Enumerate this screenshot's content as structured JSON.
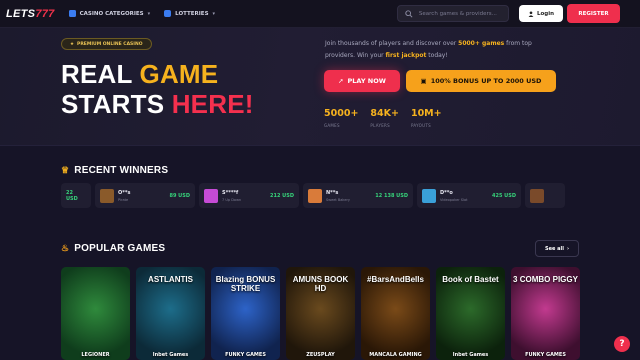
{
  "header": {
    "logo_main": "LETS",
    "logo_accent": "777",
    "menu": [
      {
        "label": "CASINO CATEGORIES",
        "icon": "grid-icon"
      },
      {
        "label": "LOTTERIES",
        "icon": "ticket-icon"
      }
    ],
    "search_placeholder": "Search games & providers...",
    "login_label": "Login",
    "register_label": "REGISTER"
  },
  "hero": {
    "badge": "PREMIUM ONLINE CASINO",
    "headline_line1_a": "REAL ",
    "headline_line1_b": "GAME",
    "headline_line2_a": "STARTS ",
    "headline_line2_b": "HERE!",
    "sub_a": "Join thousands of players and discover over ",
    "sub_highlight1": "5000+ games",
    "sub_b": " from top providers. Win your ",
    "sub_highlight2": "first jackpot",
    "sub_c": " today!",
    "play_label": "PLAY NOW",
    "bonus_label": "100% BONUS UP TO 2000 USD",
    "stats": [
      {
        "value": "5000+",
        "label": "GAMES"
      },
      {
        "value": "84K+",
        "label": "PLAYERS"
      },
      {
        "value": "10M+",
        "label": "PAYOUTS"
      }
    ]
  },
  "recent_winners": {
    "title": "RECENT WINNERS",
    "items": [
      {
        "name": "",
        "game": "",
        "amount": "22 USD",
        "color": "#3a3346"
      },
      {
        "name": "O**s",
        "game": "Pirate",
        "amount": "89 USD",
        "color": "#8a5a2a"
      },
      {
        "name": "S****f",
        "game": "7 Up Down",
        "amount": "212 USD",
        "color": "#c64bd6"
      },
      {
        "name": "N**s",
        "game": "Sweet Bakery",
        "amount": "12 138 USD",
        "color": "#d97b3a"
      },
      {
        "name": "D**o",
        "game": "Videopoker Slot",
        "amount": "425 USD",
        "color": "#3aa0d9"
      },
      {
        "name": "",
        "game": "",
        "amount": "",
        "color": "#7a4a2a"
      }
    ]
  },
  "popular_games": {
    "title": "POPULAR GAMES",
    "see_all": "See all",
    "items": [
      {
        "title": "",
        "provider": "LEGIONER",
        "bg": [
          "#2f8a3c",
          "#0f3d1c"
        ]
      },
      {
        "title": "ASTLANTIS",
        "provider": "Inbet Games",
        "bg": [
          "#1d6d8a",
          "#0c2a38"
        ]
      },
      {
        "title": "Blazing BONUS STRIKE",
        "provider": "FUNKY GAMES",
        "bg": [
          "#2d63c8",
          "#10234f"
        ]
      },
      {
        "title": "AMUNS BOOK HD",
        "provider": "ZEUSPLAY",
        "bg": [
          "#6a4a1e",
          "#20160a"
        ]
      },
      {
        "title": "#BarsAndBells",
        "provider": "MANCALA GAMING",
        "bg": [
          "#7a4a18",
          "#2a1706"
        ]
      },
      {
        "title": "Book of Bastet",
        "provider": "Inbet Games",
        "bg": [
          "#2c6a2a",
          "#0c220c"
        ]
      },
      {
        "title": "3 COMBO PIGGY",
        "provider": "FUNKY GAMES",
        "bg": [
          "#c23a8f",
          "#3e0f2f"
        ]
      }
    ]
  },
  "help_label": "?",
  "colors": {
    "accent_red": "#ef2f4d",
    "accent_gold": "#f6b21e",
    "win_green": "#36d27a"
  }
}
